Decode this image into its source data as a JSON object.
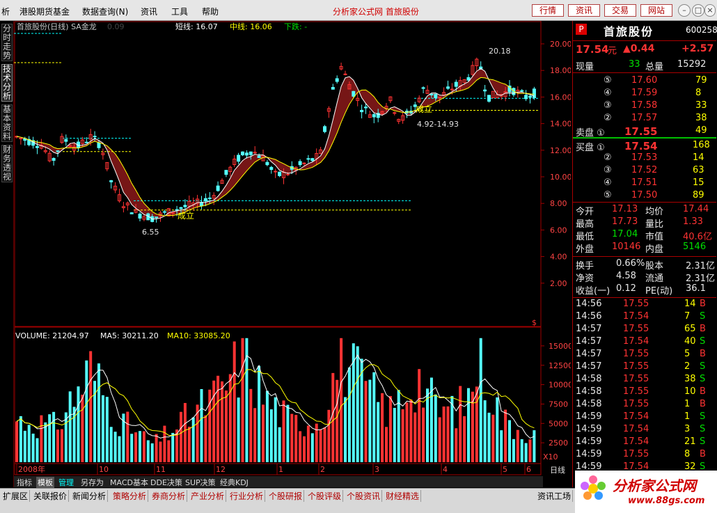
{
  "menu": {
    "items": [
      "析",
      "港股期货基金",
      "数据查询(N)",
      "资讯",
      "工具",
      "帮助"
    ],
    "center_title": "分析家公式网 首旅股份",
    "right_buttons": [
      "行情",
      "资讯",
      "交易",
      "网站"
    ]
  },
  "left_tabs": [
    "分时走势",
    "技术分析",
    "基本资料",
    "财务透视"
  ],
  "chart_header": {
    "title": "首旅股份(日线) SA金龙",
    "faded": "0.09",
    "short_line": "短线: 16.07",
    "mid_line": "中线: 16.06",
    "down_label": "下跌: -"
  },
  "price_axis": [
    "20.00",
    "18.00",
    "16.00",
    "14.00",
    "12.00",
    "10.00",
    "8.00",
    "6.00",
    "4.00",
    "2.00"
  ],
  "volume_header": {
    "volume": "VOLUME: 21204.97",
    "ma5": "MA5: 30211.20",
    "ma10": "MA10: 33085.20"
  },
  "volume_axis": [
    "15000",
    "12500",
    "10000",
    "7500",
    "5000",
    "2500"
  ],
  "volume_axis_unit": "X10",
  "x_labels": [
    "2008年",
    "10",
    "11",
    "12",
    "1",
    "2",
    "3",
    "4",
    "5",
    "6"
  ],
  "period_label": "日线",
  "annotations": {
    "high": "20.18",
    "low": "6.55",
    "cheng_li_1": "成立",
    "cheng_li_2": "成立",
    "range": "4.92-14.93",
    "dollar": "$"
  },
  "bottom_tabs": [
    "指标",
    "模板",
    "管理",
    "另存为",
    "MACD基本",
    "DDE决策",
    "SUP决策",
    "经典KDJ"
  ],
  "bottom_bar": [
    "扩展区",
    "关联报价",
    "新闻分析",
    "策略分析",
    "券商分析",
    "产业分析",
    "行业分析",
    "个股研报",
    "个股评级",
    "个股资讯",
    "财经精选",
    "资讯工场"
  ],
  "stock": {
    "flag": "P",
    "name": "首旅股份",
    "code": "600258",
    "price": "17.54",
    "price_unit": "元",
    "change": "▲0.44",
    "change_pct": "+2.57",
    "xianliang_label": "现量",
    "xianliang": "33",
    "zongliang_label": "总量",
    "zongliang": "15292"
  },
  "sell_orders": [
    {
      "lvl": "⑤",
      "price": "17.60",
      "vol": "79"
    },
    {
      "lvl": "④",
      "price": "17.59",
      "vol": "8"
    },
    {
      "lvl": "③",
      "price": "17.58",
      "vol": "33"
    },
    {
      "lvl": "②",
      "price": "17.57",
      "vol": "38"
    },
    {
      "lvl": "卖盘 ①",
      "price": "17.55",
      "vol": "49"
    }
  ],
  "buy_orders": [
    {
      "lvl": "买盘 ①",
      "price": "17.54",
      "vol": "168"
    },
    {
      "lvl": "②",
      "price": "17.53",
      "vol": "14"
    },
    {
      "lvl": "③",
      "price": "17.52",
      "vol": "63"
    },
    {
      "lvl": "④",
      "price": "17.51",
      "vol": "15"
    },
    {
      "lvl": "⑤",
      "price": "17.50",
      "vol": "89"
    }
  ],
  "stats": [
    {
      "l1": "今开",
      "v1": "17.13",
      "l2": "均价",
      "v2": "17.44"
    },
    {
      "l1": "最高",
      "v1": "17.73",
      "l2": "量比",
      "v2": "1.33"
    },
    {
      "l1": "最低",
      "v1": "17.04",
      "l2": "市值",
      "v2": "40.6亿"
    },
    {
      "l1": "外盘",
      "v1": "10146",
      "l2": "内盘",
      "v2": "5146"
    }
  ],
  "stats2": [
    {
      "l1": "换手",
      "v1": "0.66%",
      "l2": "股本",
      "v2": "2.31亿"
    },
    {
      "l1": "净资",
      "v1": "4.58",
      "l2": "流通",
      "v2": "2.31亿"
    },
    {
      "l1": "收益(一)",
      "v1": "0.12",
      "l2": "PE(动)",
      "v2": "36.1"
    }
  ],
  "ticks": [
    {
      "t": "14:56",
      "p": "17.55",
      "v": "14",
      "s": "B"
    },
    {
      "t": "14:56",
      "p": "17.54",
      "v": "7",
      "s": "S"
    },
    {
      "t": "14:57",
      "p": "17.55",
      "v": "65",
      "s": "B"
    },
    {
      "t": "14:57",
      "p": "17.54",
      "v": "40",
      "s": "S"
    },
    {
      "t": "14:57",
      "p": "17.55",
      "v": "5",
      "s": "B"
    },
    {
      "t": "14:57",
      "p": "17.55",
      "v": "2",
      "s": "S"
    },
    {
      "t": "14:58",
      "p": "17.55",
      "v": "38",
      "s": "S"
    },
    {
      "t": "14:58",
      "p": "17.55",
      "v": "10",
      "s": "B"
    },
    {
      "t": "14:58",
      "p": "17.55",
      "v": "1",
      "s": "B"
    },
    {
      "t": "14:59",
      "p": "17.54",
      "v": "1",
      "s": "S"
    },
    {
      "t": "14:59",
      "p": "17.54",
      "v": "3",
      "s": "S"
    },
    {
      "t": "14:59",
      "p": "17.54",
      "v": "21",
      "s": "S"
    },
    {
      "t": "14:59",
      "p": "17.55",
      "v": "8",
      "s": "B"
    },
    {
      "t": "14:59",
      "p": "17.54",
      "v": "32",
      "s": "S"
    }
  ],
  "logo": {
    "name": "分析家公式网",
    "url": "www.88gs.com"
  },
  "colors": {
    "up": "#ff3333",
    "down": "#00e000",
    "cyan": "#54ffff",
    "yellow": "#ffff00",
    "frame": "#a00000"
  }
}
